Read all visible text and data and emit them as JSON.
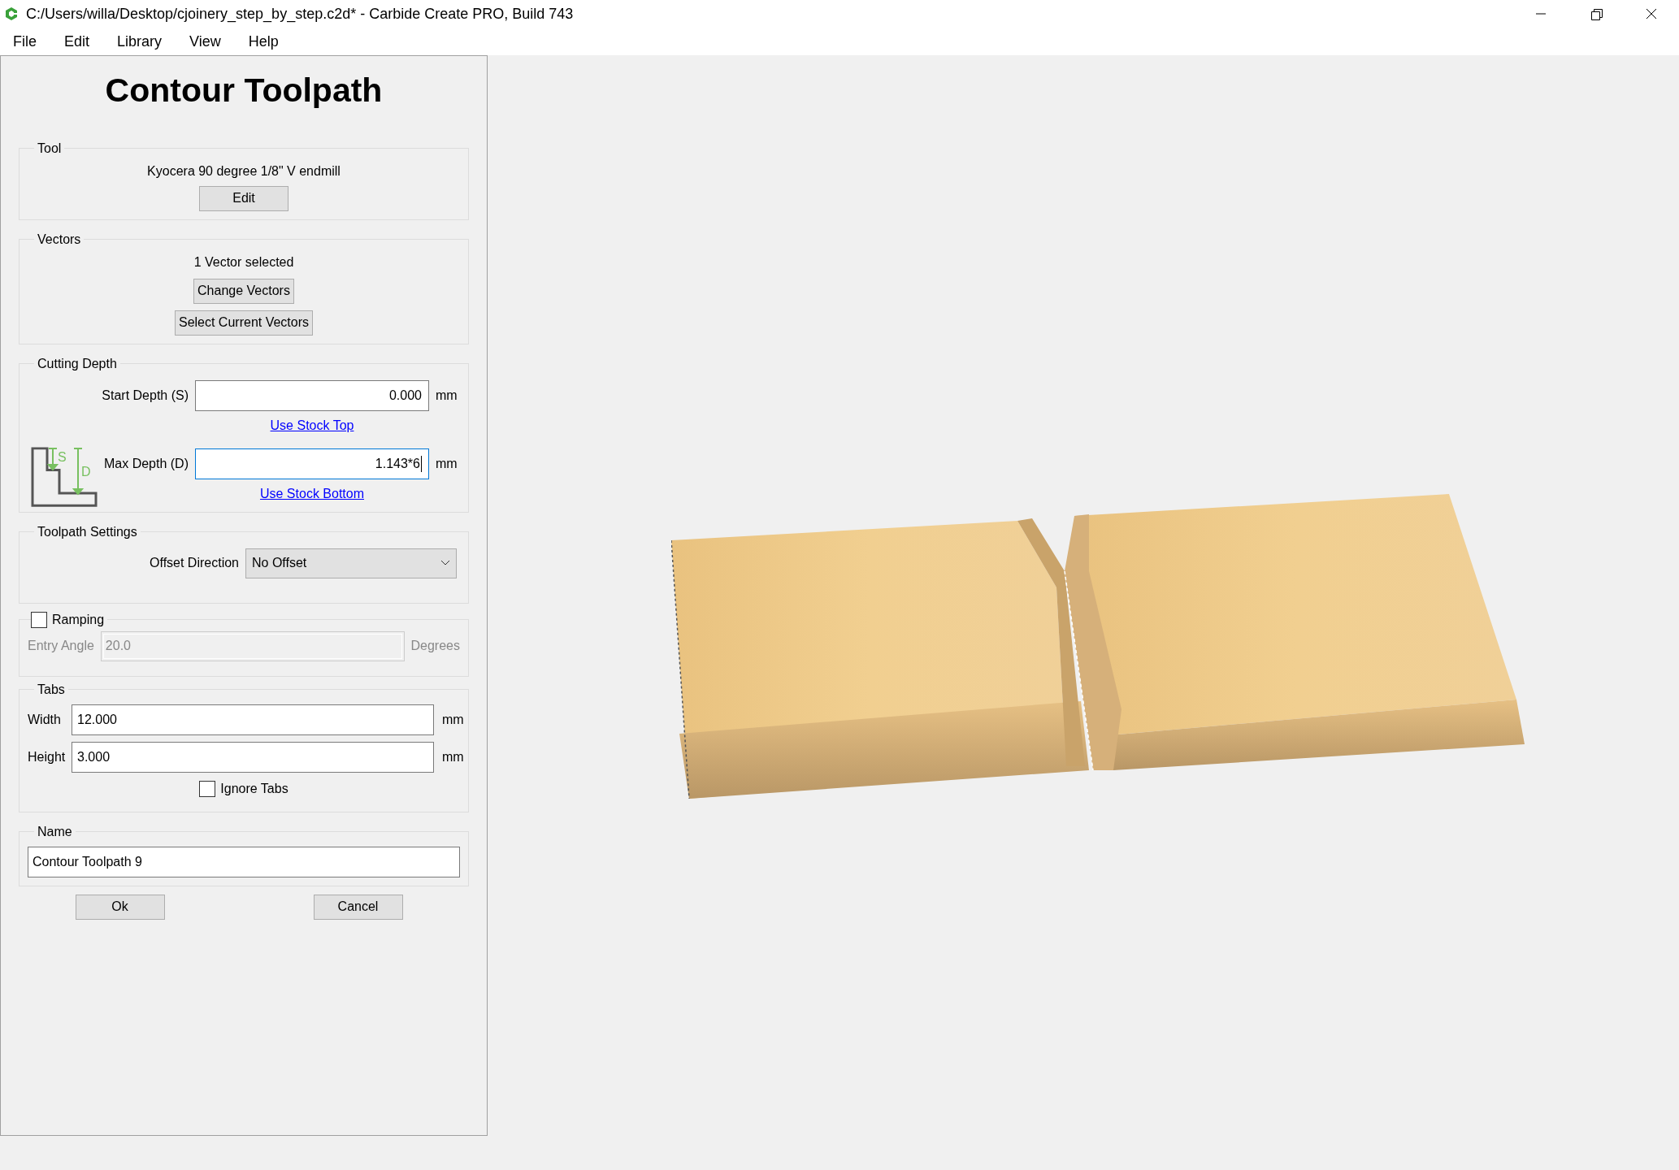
{
  "window": {
    "title": "C:/Users/willa/Desktop/cjoinery_step_by_step.c2d* - Carbide Create PRO, Build 743"
  },
  "menu": [
    "File",
    "Edit",
    "Library",
    "View",
    "Help"
  ],
  "panel": {
    "title": "Contour Toolpath",
    "tool": {
      "label": "Tool",
      "name": "Kyocera 90 degree 1/8\" V endmill",
      "button": "Edit"
    },
    "vectors": {
      "label": "Vectors",
      "status": "1 Vector selected",
      "buttons": [
        "Change Vectors",
        "Select Current Vectors"
      ]
    },
    "cutting_depth": {
      "label": "Cutting Depth",
      "fields": [
        {
          "label": "Start Depth (S)",
          "value": "0.000",
          "unit": "mm",
          "link": "Use Stock Top",
          "focused": false
        },
        {
          "label": "Max Depth (D)",
          "value": "1.143*6",
          "unit": "mm",
          "link": "Use Stock Bottom",
          "focused": true
        }
      ],
      "diagram_letters": [
        "S",
        "D"
      ]
    },
    "toolpath_settings": {
      "label": "Toolpath Settings",
      "offset_direction": {
        "label": "Offset Direction",
        "value": "No Offset"
      }
    },
    "ramping": {
      "label": "Ramping",
      "checked": false,
      "entry_angle": {
        "label": "Entry Angle",
        "value": "20.0",
        "unit": "Degrees"
      }
    },
    "tabs": {
      "label": "Tabs",
      "fields": [
        {
          "label": "Width",
          "value": "12.000",
          "unit": "mm"
        },
        {
          "label": "Height",
          "value": "3.000",
          "unit": "mm"
        }
      ],
      "ignore_tabs": {
        "label": "Ignore Tabs",
        "checked": false
      }
    },
    "name": {
      "label": "Name",
      "value": "Contour Toolpath 9"
    },
    "buttons": [
      "Ok",
      "Cancel"
    ]
  }
}
